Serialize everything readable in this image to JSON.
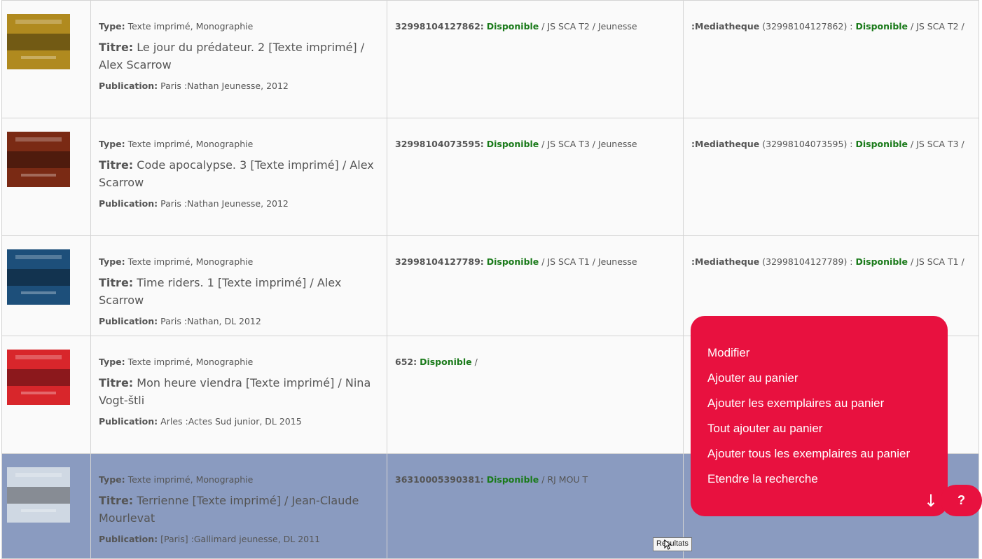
{
  "labels": {
    "type": "Type:",
    "title": "Titre:",
    "publication": "Publication:"
  },
  "records": [
    {
      "type": "Texte imprimé, Monographie",
      "title": "Le jour du prédateur. 2 [Texte imprimé] / Alex Scarrow",
      "publication": "Paris :Nathan Jeunesse, 2012",
      "ex_barcode": "32998104127862:",
      "ex_status": "Disponible",
      "ex_rest": " / JS SCA T2 / Jeunesse",
      "lib_name": ":Mediatheque",
      "lib_code": " (32998104127862) : ",
      "lib_status": "Disponible",
      "lib_rest": " / JS SCA T2 /",
      "cover_color": "#b08a1f"
    },
    {
      "type": "Texte imprimé, Monographie",
      "title": "Code apocalypse. 3 [Texte imprimé] / Alex Scarrow",
      "publication": "Paris :Nathan Jeunesse, 2012",
      "ex_barcode": "32998104073595:",
      "ex_status": "Disponible",
      "ex_rest": " / JS SCA T3 / Jeunesse",
      "lib_name": ":Mediatheque",
      "lib_code": " (32998104073595) : ",
      "lib_status": "Disponible",
      "lib_rest": " / JS SCA T3 /",
      "cover_color": "#7a2a14"
    },
    {
      "type": "Texte imprimé, Monographie",
      "title": "Time riders. 1 [Texte imprimé] / Alex Scarrow",
      "publication": "Paris :Nathan, DL 2012",
      "ex_barcode": "32998104127789:",
      "ex_status": "Disponible",
      "ex_rest": " / JS SCA T1 / Jeunesse",
      "lib_name": ":Mediatheque",
      "lib_code": " (32998104127789) : ",
      "lib_status": "Disponible",
      "lib_rest": " / JS SCA T1 /",
      "cover_color": "#1d4f7a"
    },
    {
      "type": "Texte imprimé, Monographie",
      "title": "Mon heure viendra [Texte imprimé] / Nina Vogt-štli",
      "publication": "Arles :Actes Sud junior, DL 2015",
      "ex_barcode": "652:",
      "ex_status": "Disponible",
      "ex_rest": " /",
      "lib_name": "",
      "lib_code": "",
      "lib_status": "",
      "lib_rest": "",
      "cover_color": "#d8262b"
    },
    {
      "type": "Texte imprimé, Monographie",
      "title": "Terrienne [Texte imprimé] / Jean-Claude Mourlevat",
      "publication": "[Paris] :Gallimard jeunesse, DL 2011",
      "ex_barcode": "36310005390381:",
      "ex_status": "Disponible",
      "ex_rest": " / RJ MOU T",
      "lib_name": "",
      "lib_code": "",
      "lib_status": "",
      "lib_rest": "",
      "cover_color": "#cfd8e3"
    }
  ],
  "menu": {
    "items": [
      "Modifier",
      "Ajouter au panier",
      "Ajouter les exemplaires au panier",
      "Tout ajouter au panier",
      "Ajouter tous les exemplaires au panier",
      "Etendre la recherche"
    ],
    "help_label": "?"
  },
  "tooltip": "Résultats",
  "colors": {
    "accent": "#e8113f",
    "available": "#1a7a1a",
    "selected_row": "#8a9bc0"
  }
}
